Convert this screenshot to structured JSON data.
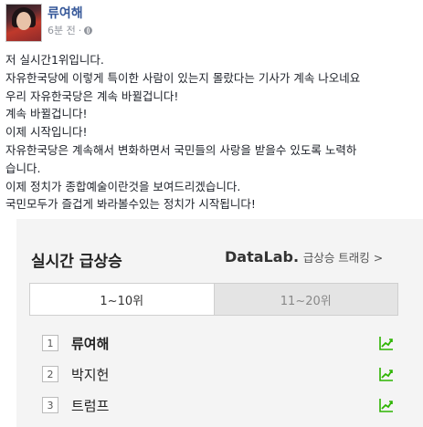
{
  "header": {
    "name": "류여해",
    "time": "6분 전",
    "separator": "·"
  },
  "post_lines": [
    "저 실시간1위입니다.",
    "자유한국당에 이렇게 특이한 사람이 있는지 몰랐다는 기사가 계속 나오네요",
    "우리 자유한국당은 계속 바뀔겁니다!",
    "계속 바뀔겁니다!",
    "이제 시작입니다!",
    "자유한국당은 계속해서 변화하면서 국민들의 사랑을 받을수 있도록 노력하",
    "습니다.",
    "이제 정치가 종합예술이란것을 보여드리겠습니다.",
    "국민모두가 즐겁게 봐라볼수있는 정치가 시작됩니다!"
  ],
  "shot": {
    "title": "실시간 급상승",
    "link_brand": "DataLab.",
    "link_text": "급상승 트래킹 >",
    "tabs": [
      "1~10위",
      "11~20위"
    ],
    "ranks": [
      {
        "num": "1",
        "name": "류여해"
      },
      {
        "num": "2",
        "name": "박지헌"
      },
      {
        "num": "3",
        "name": "트럼프"
      }
    ],
    "trend_color": "#2db400"
  }
}
